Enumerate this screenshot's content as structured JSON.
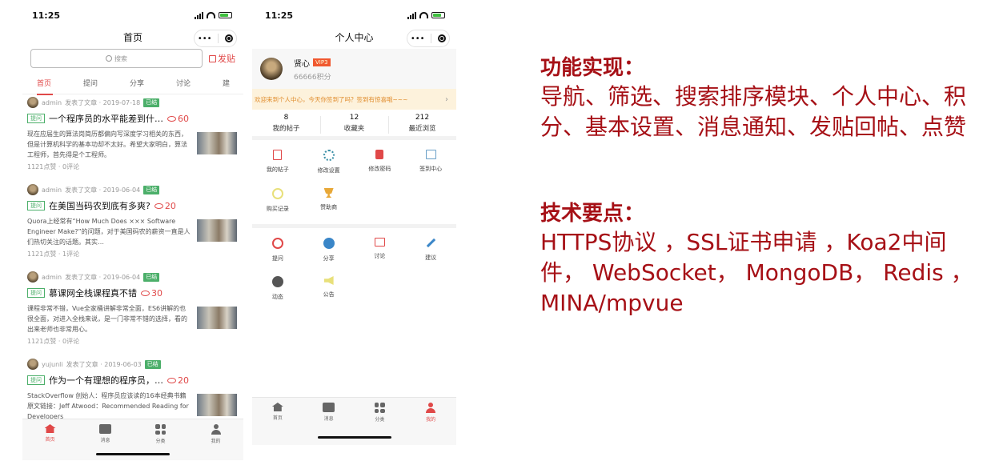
{
  "phone1": {
    "status_time": "11:25",
    "nav_title": "首页",
    "capsule_more": "•••",
    "search_placeholder": "搜索",
    "post_button": "发贴",
    "tabs": [
      "首页",
      "提问",
      "分享",
      "讨论",
      "建"
    ],
    "posts": [
      {
        "author": "admin",
        "meta": "发表了文章 · 2019-07-18",
        "status": "已结",
        "tag": "提问",
        "title": "一个程序员的水平能差到什…",
        "fav": "60",
        "excerpt": "现在应届生的算法岗简历都偏向写深度学习相关的东西，但是计算机科学的基本功却不太好。希望大家明白，算法工程师，首先得是个工程师。",
        "stats": "1121点赞 · 0评论"
      },
      {
        "author": "admin",
        "meta": "发表了文章 · 2019-06-04",
        "status": "已结",
        "tag": "提问",
        "title": "在美国当码农到底有多爽?",
        "fav": "20",
        "excerpt": "Quora上经常有“How Much Does ××× Software Engineer Make?”的问题，对于美国码农的薪资一直是人们热切关注的话题。其实…",
        "stats": "1121点赞 · 1评论"
      },
      {
        "author": "admin",
        "meta": "发表了文章 · 2019-06-04",
        "status": "已结",
        "tag": "提问",
        "title": "慕课网全栈课程真不错",
        "fav": "30",
        "excerpt": "课程非常不错，Vue全家桶讲解非常全面，ES6讲解的也很全面，对进入全栈来说，是一门非常不错的选择，看的出来老师也非常用心。",
        "stats": "1121点赞 · 0评论"
      },
      {
        "author": "yujunli",
        "meta": "发表了文章 · 2019-06-03",
        "status": "已结",
        "tag": "提问",
        "title": "作为一个有理想的程序员，…",
        "fav": "20",
        "excerpt": "StackOverflow 创始人：程序员应该读的16本经典书籍原文链接：Jeff Atwood：Recommended Reading for Developers",
        "stats": ""
      }
    ],
    "tabbar": [
      "首页",
      "消息",
      "分类",
      "我的"
    ]
  },
  "phone2": {
    "status_time": "11:25",
    "nav_title": "个人中心",
    "capsule_more": "•••",
    "username": "贤心",
    "vip": "VIP3",
    "points": "66666积分",
    "notice": "欢迎来到个人中心，今天你签到了吗？签到有惊喜哦~~~",
    "stats": [
      {
        "num": "8",
        "label": "我的帖子"
      },
      {
        "num": "12",
        "label": "收藏夹"
      },
      {
        "num": "212",
        "label": "最近浏览"
      }
    ],
    "grid1": [
      "我的帖子",
      "修改设置",
      "修改密码",
      "签到中心",
      "购买记录",
      "赞助商"
    ],
    "grid2": [
      "提问",
      "分享",
      "讨论",
      "建议",
      "动态",
      "公告"
    ],
    "tabbar": [
      "首页",
      "消息",
      "分类",
      "我的"
    ]
  },
  "info": {
    "h1": "功能实现：",
    "p1": "导航、筛选、搜索排序模块、个人中心、积分、基本设置、消息通知、发贴回帖、点赞",
    "h2": "技术要点：",
    "p2": "HTTPS协议 ，SSL证书申请 ，Koa2中间件， WebSocket， MongoDB， Redis ，MINA/mpvue"
  },
  "colors": {
    "accent": "#e04848",
    "done": "#4caf6a",
    "headline": "#a61016",
    "notice_bg": "#fdf2dc"
  }
}
